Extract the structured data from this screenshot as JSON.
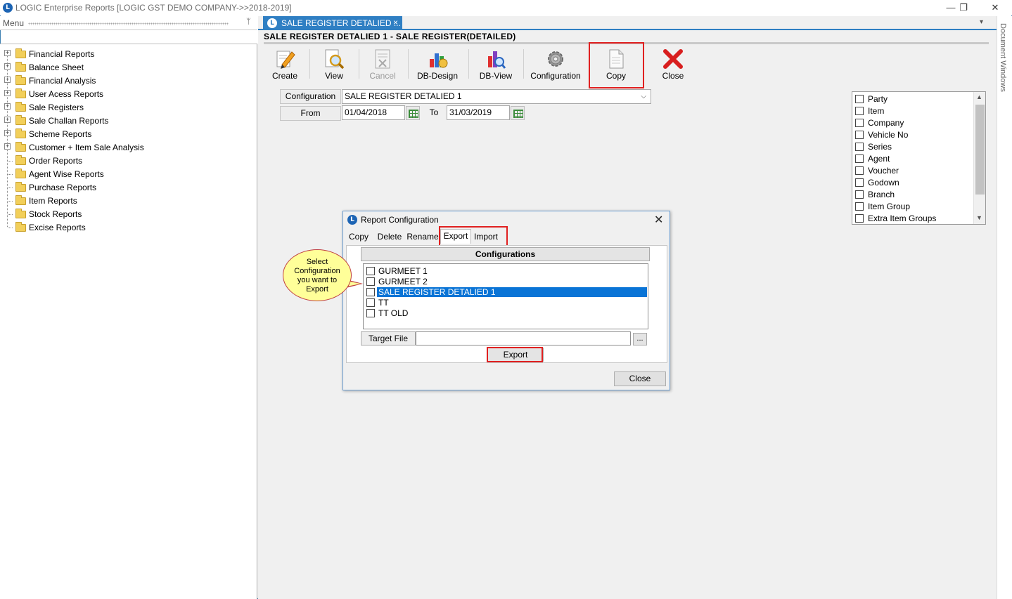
{
  "window": {
    "title": "LOGIC Enterprise Reports  [LOGIC GST DEMO COMPANY->>2018-2019]",
    "minimize": "—",
    "restore": "❐",
    "close": "✕"
  },
  "menu": {
    "label": "Menu",
    "pin": "ᛘ",
    "items": [
      {
        "label": "Financial Reports",
        "expandable": true
      },
      {
        "label": "Balance Sheet",
        "expandable": true
      },
      {
        "label": "Financial Analysis",
        "expandable": true
      },
      {
        "label": "User Acess Reports",
        "expandable": true
      },
      {
        "label": "Sale Registers",
        "expandable": true
      },
      {
        "label": "Sale Challan Reports",
        "expandable": true
      },
      {
        "label": "Scheme Reports",
        "expandable": true
      },
      {
        "label": "Customer + Item Sale Analysis",
        "expandable": true
      },
      {
        "label": "Order Reports",
        "expandable": false
      },
      {
        "label": "Agent Wise Reports",
        "expandable": false
      },
      {
        "label": "Purchase Reports",
        "expandable": false
      },
      {
        "label": "Item Reports",
        "expandable": false
      },
      {
        "label": "Stock Reports",
        "expandable": false
      },
      {
        "label": "Excise Reports",
        "expandable": false
      }
    ]
  },
  "doc_tab": {
    "label": "SALE REGISTER DETALIED ...",
    "close": "×"
  },
  "side_panel": {
    "label": "Document Windows"
  },
  "doc_title": "SALE REGISTER DETALIED 1 - SALE REGISTER(DETAILED)",
  "toolbar": {
    "create": "Create",
    "view": "View",
    "cancel": "Cancel",
    "db_design": "DB-Design",
    "db_view": "DB-View",
    "configuration": "Configuration",
    "copy": "Copy",
    "close": "Close"
  },
  "form": {
    "configuration_label": "Configuration",
    "configuration_value": "SALE REGISTER DETALIED 1",
    "from_label": "From",
    "from_value": "01/04/2018",
    "to_label": "To",
    "to_value": "31/03/2019"
  },
  "checklist": {
    "items": [
      "Party",
      "Item",
      "Company",
      "Vehicle No",
      "Series",
      "Agent",
      "Voucher",
      "Godown",
      "Branch",
      "Item Group",
      "Extra Item Groups"
    ]
  },
  "dialog": {
    "title": "Report Configuration",
    "tabs": [
      "Copy",
      "Delete",
      "Rename",
      "Export",
      "Import"
    ],
    "selected_tab": "Export",
    "configurations_header": "Configurations",
    "configurations": [
      {
        "label": "GURMEET 1",
        "selected": false
      },
      {
        "label": "GURMEET 2",
        "selected": false
      },
      {
        "label": "SALE REGISTER DETALIED 1",
        "selected": true
      },
      {
        "label": "TT",
        "selected": false
      },
      {
        "label": "TT OLD",
        "selected": false
      }
    ],
    "target_file_label": "Target File",
    "target_file_value": "",
    "browse": "...",
    "export_button": "Export",
    "close_button": "Close"
  },
  "callout": {
    "lines": [
      "Select",
      "Configuration",
      "you want to",
      "Export"
    ]
  },
  "colors": {
    "accent": "#2f7fc3",
    "highlight": "#0a74d6",
    "annotation": "#e02020",
    "callout_fill": "#ffff99"
  }
}
